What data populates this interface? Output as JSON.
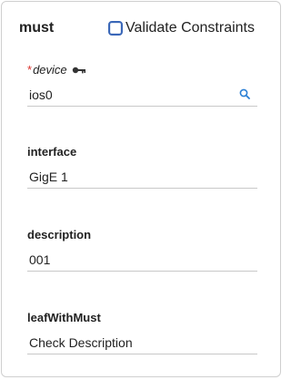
{
  "header": {
    "title": "must",
    "validate_label": "Validate Constraints",
    "validate_checked": false
  },
  "fields": {
    "device": {
      "required_mark": "*",
      "label": "device",
      "value": "ios0",
      "key_icon": "key-icon",
      "search_icon": "search-icon"
    },
    "interface": {
      "label": "interface",
      "value": "GigE 1"
    },
    "description": {
      "label": "description",
      "value": "001"
    },
    "leafWithMust": {
      "label": "leafWithMust",
      "value": "Check Description"
    }
  },
  "colors": {
    "accent": "#3a67b8",
    "required": "#d9302b",
    "search_icon": "#2a7fd4",
    "border": "#cfcfcf"
  }
}
